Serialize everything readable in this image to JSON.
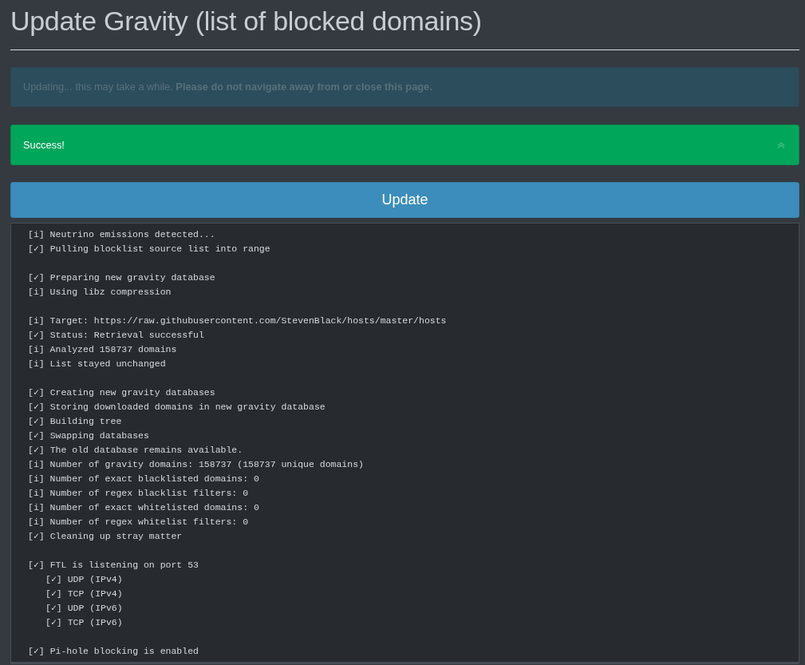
{
  "title": "Update Gravity (list of blocked domains)",
  "info_alert": {
    "text": "Updating... this may take a while. **Please do not navigate away from or close this page.**"
  },
  "success_alert": {
    "text": "Success!"
  },
  "update_button": {
    "label": "Update"
  },
  "log": {
    "groups": [
      {
        "lines": [
          {
            "text": "[i] Neutrino emissions detected..."
          },
          {
            "text": "[✓] Pulling blocklist source list into range"
          }
        ]
      },
      {
        "lines": [
          {
            "text": "[✓] Preparing new gravity database"
          },
          {
            "text": "[i] Using libz compression"
          }
        ]
      },
      {
        "lines": [
          {
            "text": "[i] Target: https://raw.githubusercontent.com/StevenBlack/hosts/master/hosts"
          },
          {
            "text": "[✓] Status: Retrieval successful"
          },
          {
            "text": "[i] Analyzed 158737 domains"
          },
          {
            "text": "[i] List stayed unchanged"
          }
        ]
      },
      {
        "lines": [
          {
            "text": "[✓] Creating new gravity databases"
          },
          {
            "text": "[✓] Storing downloaded domains in new gravity database"
          },
          {
            "text": "[✓] Building tree"
          },
          {
            "text": "[✓] Swapping databases"
          },
          {
            "text": "[✓] The old database remains available."
          },
          {
            "text": "[i] Number of gravity domains: 158737 (158737 unique domains)"
          },
          {
            "text": "[i] Number of exact blacklisted domains: 0"
          },
          {
            "text": "[i] Number of regex blacklist filters: 0"
          },
          {
            "text": "[i] Number of exact whitelisted domains: 0"
          },
          {
            "text": "[i] Number of regex whitelist filters: 0"
          },
          {
            "text": "[✓] Cleaning up stray matter"
          }
        ]
      },
      {
        "lines": [
          {
            "text": "[✓] FTL is listening on port 53",
            "children": [
              {
                "text": "[✓] UDP (IPv4)"
              },
              {
                "text": "[✓] TCP (IPv4)"
              },
              {
                "text": "[✓] UDP (IPv6)"
              },
              {
                "text": "[✓] TCP (IPv6)"
              }
            ]
          }
        ]
      },
      {
        "lines": [
          {
            "text": "[✓] Pi-hole blocking is enabled"
          }
        ]
      }
    ]
  }
}
